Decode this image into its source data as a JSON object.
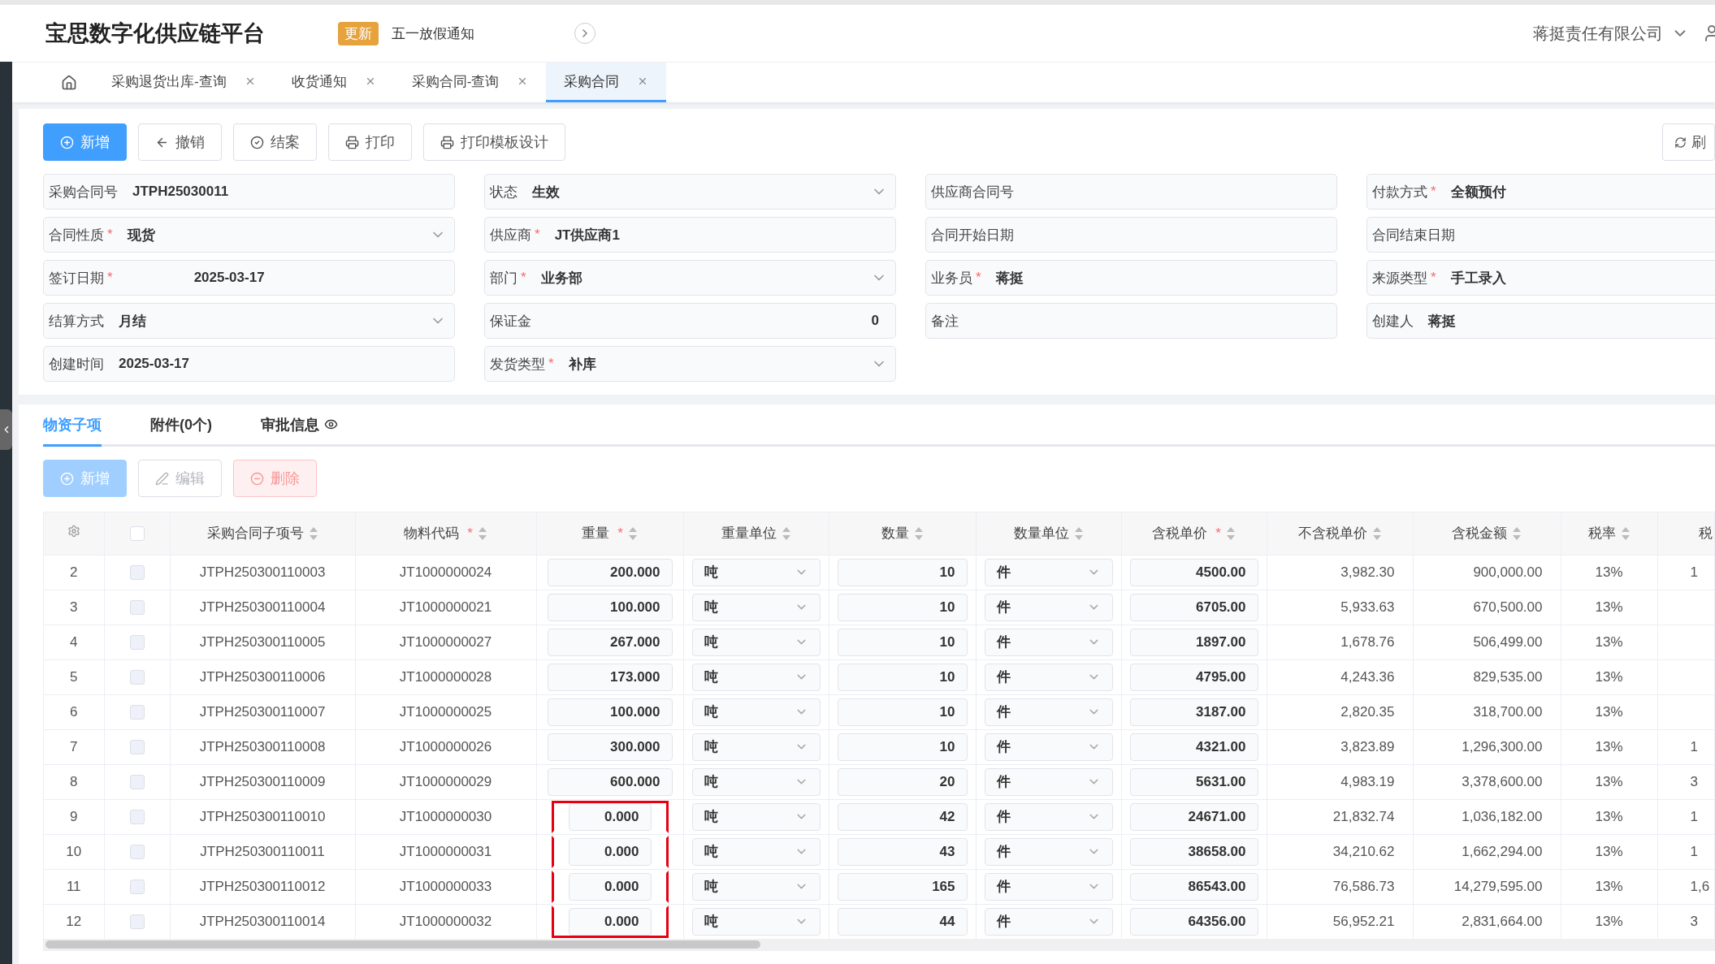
{
  "header": {
    "title": "宝思数字化供应链平台",
    "badge": "更新",
    "notice": "五一放假通知",
    "company": "蒋挺责任有限公司"
  },
  "page_tabs": [
    {
      "label": "采购退货出库-查询",
      "selected": false
    },
    {
      "label": "收货通知",
      "selected": false
    },
    {
      "label": "采购合同-查询",
      "selected": false
    },
    {
      "label": "采购合同",
      "selected": true
    }
  ],
  "toolbar": [
    {
      "label": "新增",
      "kind": "primary"
    },
    {
      "label": "撤销",
      "kind": "default"
    },
    {
      "label": "结案",
      "kind": "default"
    },
    {
      "label": "打印",
      "kind": "default"
    },
    {
      "label": "打印模板设计",
      "kind": "default"
    }
  ],
  "refresh_button": "刷",
  "fields": [
    {
      "label": "采购合同号",
      "value": "JTPH25030011",
      "kind": "text"
    },
    {
      "label": "状态",
      "value": "生效",
      "kind": "select"
    },
    {
      "label": "供应商合同号",
      "kind": "text"
    },
    {
      "label": "付款方式",
      "required_mark": "*",
      "value": "全额预付",
      "kind": "text"
    },
    {
      "label": "合同性质",
      "required_mark": "*",
      "value": "现货",
      "kind": "select"
    },
    {
      "label": "供应商",
      "required_mark": "*",
      "value": "JT供应商1",
      "kind": "text"
    },
    {
      "label": "合同开始日期",
      "kind": "text"
    },
    {
      "label": "合同结束日期",
      "kind": "text"
    },
    {
      "label": "签订日期",
      "required_mark": "*",
      "value": "2025-03-17",
      "kind": "date"
    },
    {
      "label": "部门",
      "required_mark": "*",
      "value": "业务部",
      "kind": "select"
    },
    {
      "label": "业务员",
      "required_mark": "*",
      "value": "蒋挺",
      "kind": "text"
    },
    {
      "label": "来源类型",
      "required_mark": "*",
      "value": "手工录入",
      "kind": "text"
    },
    {
      "label": "结算方式",
      "value": "月结",
      "kind": "select"
    },
    {
      "label": "保证金",
      "value": "0",
      "kind": "number"
    },
    {
      "label": "备注",
      "kind": "text"
    },
    {
      "label": "创建人",
      "value": "蒋挺",
      "kind": "text"
    },
    {
      "label": "创建时间",
      "value": "2025-03-17",
      "kind": "text"
    },
    {
      "label": "发货类型",
      "required_mark": "*",
      "value": "补库",
      "kind": "select"
    }
  ],
  "detail_tabs": [
    {
      "label": "物资子项",
      "selected": true
    },
    {
      "label": "附件(0个)",
      "selected": false
    },
    {
      "label": "审批信息",
      "selected": false
    }
  ],
  "detail_toolbar": [
    {
      "label": "新增",
      "kind": "primary",
      "disabled": true
    },
    {
      "label": "编辑",
      "kind": "default",
      "disabled": true
    },
    {
      "label": "删除",
      "kind": "danger",
      "disabled": true
    }
  ],
  "table": {
    "select_all_checked": false,
    "columns": [
      {
        "label": "采购合同子项号",
        "sortable": true
      },
      {
        "label": "物料代码",
        "required_mark": "*",
        "sortable": true
      },
      {
        "label": "重量",
        "required_mark": "*",
        "sortable": true
      },
      {
        "label": "重量单位",
        "sortable": true
      },
      {
        "label": "数量",
        "sortable": true
      },
      {
        "label": "数量单位",
        "sortable": true
      },
      {
        "label": "含税单价",
        "required_mark": "*",
        "sortable": true
      },
      {
        "label": "不含税单价",
        "sortable": true
      },
      {
        "label": "含税金额",
        "sortable": true
      },
      {
        "label": "税率",
        "sortable": true
      },
      {
        "label": "税",
        "sortable": false
      }
    ],
    "rows": [
      {
        "index": "2",
        "item_no": "JTPH250300110003",
        "material": "JT1000000024",
        "weight": "200.000",
        "weight_unit": "吨",
        "qty": "10",
        "qty_unit": "件",
        "price": "4500.00",
        "price_ex_tax": "3,982.30",
        "amount": "900,000.00",
        "tax_rate": "13%",
        "column_11": "1",
        "highlighted": false,
        "checked": false
      },
      {
        "index": "3",
        "item_no": "JTPH250300110004",
        "material": "JT1000000021",
        "weight": "100.000",
        "weight_unit": "吨",
        "qty": "10",
        "qty_unit": "件",
        "price": "6705.00",
        "price_ex_tax": "5,933.63",
        "amount": "670,500.00",
        "tax_rate": "13%",
        "highlighted": false,
        "checked": false
      },
      {
        "index": "4",
        "item_no": "JTPH250300110005",
        "material": "JT1000000027",
        "weight": "267.000",
        "weight_unit": "吨",
        "qty": "10",
        "qty_unit": "件",
        "price": "1897.00",
        "price_ex_tax": "1,678.76",
        "amount": "506,499.00",
        "tax_rate": "13%",
        "highlighted": false,
        "checked": false
      },
      {
        "index": "5",
        "item_no": "JTPH250300110006",
        "material": "JT1000000028",
        "weight": "173.000",
        "weight_unit": "吨",
        "qty": "10",
        "qty_unit": "件",
        "price": "4795.00",
        "price_ex_tax": "4,243.36",
        "amount": "829,535.00",
        "tax_rate": "13%",
        "highlighted": false,
        "checked": false
      },
      {
        "index": "6",
        "item_no": "JTPH250300110007",
        "material": "JT1000000025",
        "weight": "100.000",
        "weight_unit": "吨",
        "qty": "10",
        "qty_unit": "件",
        "price": "3187.00",
        "price_ex_tax": "2,820.35",
        "amount": "318,700.00",
        "tax_rate": "13%",
        "highlighted": false,
        "checked": false
      },
      {
        "index": "7",
        "item_no": "JTPH250300110008",
        "material": "JT1000000026",
        "weight": "300.000",
        "weight_unit": "吨",
        "qty": "10",
        "qty_unit": "件",
        "price": "4321.00",
        "price_ex_tax": "3,823.89",
        "amount": "1,296,300.00",
        "tax_rate": "13%",
        "column_11": "1",
        "highlighted": false,
        "checked": false
      },
      {
        "index": "8",
        "item_no": "JTPH250300110009",
        "material": "JT1000000029",
        "weight": "600.000",
        "weight_unit": "吨",
        "qty": "20",
        "qty_unit": "件",
        "price": "5631.00",
        "price_ex_tax": "4,983.19",
        "amount": "3,378,600.00",
        "tax_rate": "13%",
        "column_11": "3",
        "highlighted": false,
        "checked": false
      },
      {
        "index": "9",
        "item_no": "JTPH250300110010",
        "material": "JT1000000030",
        "weight": "0.000",
        "weight_unit": "吨",
        "qty": "42",
        "qty_unit": "件",
        "price": "24671.00",
        "price_ex_tax": "21,832.74",
        "amount": "1,036,182.00",
        "tax_rate": "13%",
        "column_11": "1",
        "highlighted": true,
        "checked": false
      },
      {
        "index": "10",
        "item_no": "JTPH250300110011",
        "material": "JT1000000031",
        "weight": "0.000",
        "weight_unit": "吨",
        "qty": "43",
        "qty_unit": "件",
        "price": "38658.00",
        "price_ex_tax": "34,210.62",
        "amount": "1,662,294.00",
        "tax_rate": "13%",
        "column_11": "1",
        "highlighted": true,
        "checked": false
      },
      {
        "index": "11",
        "item_no": "JTPH250300110012",
        "material": "JT1000000033",
        "weight": "0.000",
        "weight_unit": "吨",
        "qty": "165",
        "qty_unit": "件",
        "price": "86543.00",
        "price_ex_tax": "76,586.73",
        "amount": "14,279,595.00",
        "tax_rate": "13%",
        "column_11": "1,6",
        "highlighted": true,
        "checked": false
      },
      {
        "index": "12",
        "item_no": "JTPH250300110014",
        "material": "JT1000000032",
        "weight": "0.000",
        "weight_unit": "吨",
        "qty": "44",
        "qty_unit": "件",
        "price": "64356.00",
        "price_ex_tax": "56,952.21",
        "amount": "2,831,664.00",
        "tax_rate": "13%",
        "column_11": "3",
        "highlighted": true,
        "checked": false
      }
    ]
  }
}
